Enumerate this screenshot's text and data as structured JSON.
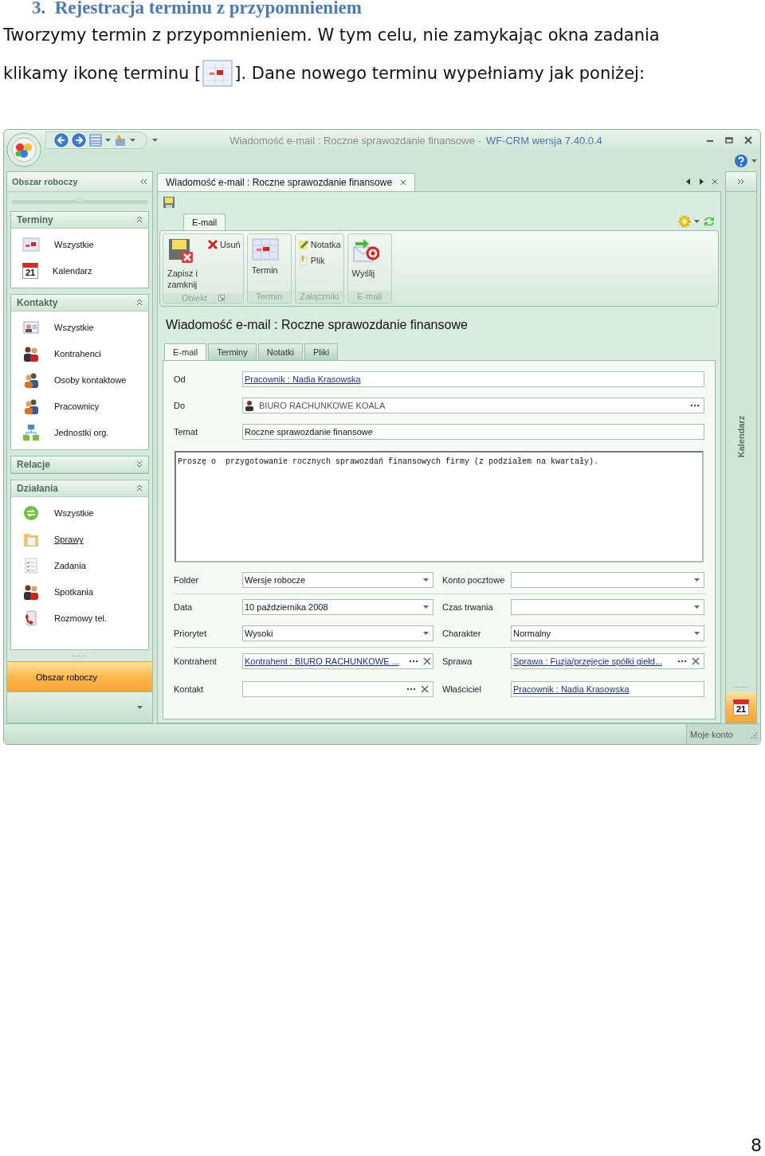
{
  "heading": {
    "number": "3.",
    "title": "Rejestracja terminu z przypomnieniem"
  },
  "intro": {
    "first_line": "Tworzymy termin z przypomnieniem. W tym celu, nie zamykając okna zadania",
    "before_icon": "klikamy ikonę terminu [",
    "after_icon": "]. Dane nowego terminu wypełniamy jak poniżej:"
  },
  "window": {
    "document_title": "Wiadomość e-mail : Roczne sprawozdanie finansowe -",
    "app_title": "WF-CRM wersja 7.40.0.4"
  },
  "sidebar": {
    "title": "Obszar roboczy",
    "sections": [
      {
        "title": "Terminy",
        "expanded": true,
        "items": [
          {
            "label": "Wszystkie",
            "kind": "appointments",
            "hovered": false
          },
          {
            "label": "Kalendarz",
            "kind": "calendar",
            "day": "21",
            "hovered": false
          }
        ]
      },
      {
        "title": "Kontakty",
        "expanded": true,
        "items": [
          {
            "label": "Wszystkie",
            "kind": "contacts",
            "hovered": false
          },
          {
            "label": "Kontrahenci",
            "kind": "partners",
            "hovered": false
          },
          {
            "label": "Osoby kontaktowe",
            "kind": "contact-persons",
            "hovered": false
          },
          {
            "label": "Pracownicy",
            "kind": "employees",
            "hovered": false
          },
          {
            "label": "Jednostki org.",
            "kind": "org-units",
            "hovered": false
          }
        ]
      },
      {
        "title": "Relacje",
        "expanded": false
      },
      {
        "title": "Działania",
        "expanded": true,
        "items": [
          {
            "label": "Wszystkie",
            "kind": "activities",
            "hovered": false
          },
          {
            "label": "Sprawy",
            "kind": "cases",
            "hovered": true
          },
          {
            "label": "Zadania",
            "kind": "tasks",
            "hovered": false
          },
          {
            "label": "Spotkania",
            "kind": "meetings",
            "hovered": false
          },
          {
            "label": "Rozmowy tel.",
            "kind": "calls",
            "hovered": false
          }
        ]
      }
    ],
    "workspace_button": "Obszar roboczy"
  },
  "document_tab": "Wiadomość e-mail : Roczne sprawozdanie finansowe",
  "ribbon": {
    "tab": "E-mail",
    "groups": [
      {
        "label": "Obiekt",
        "buttons": [
          {
            "label": "Zapisz i zamknij",
            "kind": "save-close"
          },
          {
            "label": "Usuń",
            "kind": "delete"
          }
        ]
      },
      {
        "label": "Termin",
        "buttons": [
          {
            "label": "Termin",
            "kind": "appointment"
          }
        ]
      },
      {
        "label": "Załączniki",
        "buttons": [
          {
            "label": "Notatka",
            "kind": "note"
          },
          {
            "label": "Plik",
            "kind": "file"
          }
        ]
      },
      {
        "label": "E-mail",
        "buttons": [
          {
            "label": "Wyślij",
            "kind": "send"
          }
        ]
      }
    ]
  },
  "form": {
    "title": "Wiadomość e-mail : Roczne sprawozdanie finansowe",
    "tabs": [
      {
        "label": "E-mail",
        "selected": true
      },
      {
        "label": "Terminy",
        "selected": false
      },
      {
        "label": "Notatki",
        "selected": false
      },
      {
        "label": "Pliki",
        "selected": false
      }
    ],
    "fields": [
      {
        "label": "Od",
        "kind": "link",
        "value": "Pracownik : Nadia Krasowska"
      },
      {
        "label": "Do",
        "kind": "recipient",
        "value": "BIURO RACHUNKOWE KOALA"
      },
      {
        "label": "Temat",
        "kind": "text",
        "value": "Roczne sprawozdanie finansowe"
      }
    ],
    "body": "Proszę o  przygotowanie rocznych sprawozdań finansowych firmy (z podziałem na kwartały).",
    "detail_groups": [
      [
        {
          "left": {
            "label": "Folder",
            "kind": "dropdown",
            "value": "Wersje robocze"
          },
          "right": {
            "label": "Konto pocztowe",
            "kind": "dropdown"
          }
        }
      ],
      [
        {
          "left": {
            "label": "Data",
            "kind": "dropdown",
            "value": "10 października 2008"
          },
          "right": {
            "label": "Czas trwania",
            "kind": "dropdown"
          }
        },
        {
          "left": {
            "label": "Priorytet",
            "kind": "dropdown",
            "value": "Wysoki"
          },
          "right": {
            "label": "Charakter",
            "kind": "dropdown",
            "value": "Normalny"
          }
        }
      ],
      [
        {
          "left": {
            "label": "Kontrahent",
            "kind": "lookup",
            "value": "Kontrahent : BIURO RACHUNKOWE ..."
          },
          "right": {
            "label": "Sprawa",
            "kind": "lookup",
            "value": "Sprawa : Fuzja/przejęcie spółki giełd..."
          }
        },
        {
          "left": {
            "label": "Kontakt",
            "kind": "lookup"
          },
          "right": {
            "label": "Właściciel",
            "kind": "link",
            "value": "Pracownik : Nadia Krasowska"
          }
        }
      ]
    ]
  },
  "right_pane": {
    "title": "Kalendarz",
    "calendar_day": "21"
  },
  "status_bar": {
    "account": "Moje konto"
  },
  "page_number": "8"
}
